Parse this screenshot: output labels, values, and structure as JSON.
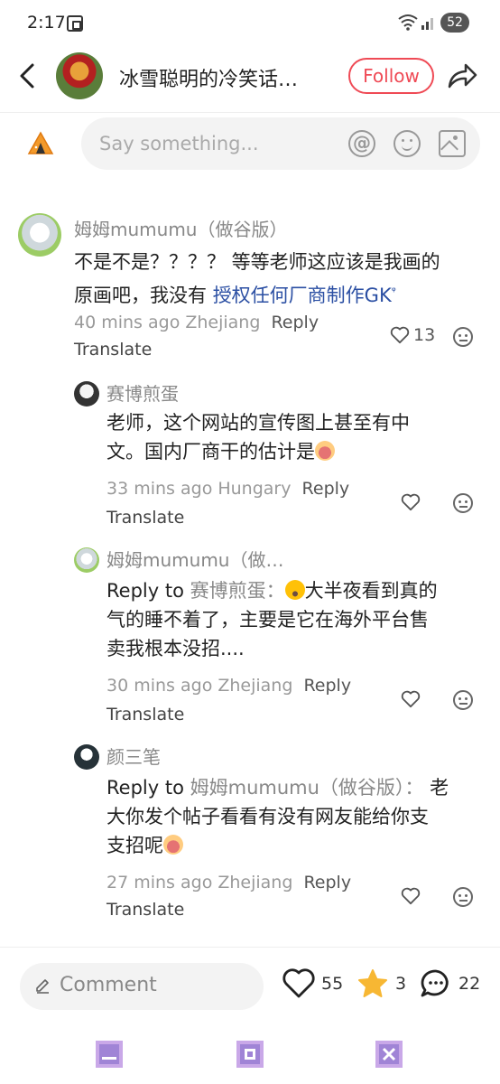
{
  "status_bar": {
    "time": "2:17",
    "battery": "52"
  },
  "header": {
    "title": "冰雪聪明的冷笑话…",
    "follow_label": "Follow"
  },
  "say_bar": {
    "placeholder": "Say something..."
  },
  "comments": [
    {
      "name": "姆姆mumumu（做谷版）",
      "line1": "不是不是？？？？ 等等老师这应该是我画的",
      "line2_prefix": "原画吧，我没有 ",
      "line2_link": "授权任何厂商制作GK",
      "time_location": "40 mins ago Zhejiang",
      "reply": "Reply",
      "translate": "Translate",
      "likes": "13"
    },
    {
      "name": "赛博煎蛋",
      "line1": "老师，这个网站的宣传图上甚至有中",
      "line2": "文。国内厂商干的估计是",
      "time_location": "33 mins ago Hungary",
      "reply": "Reply",
      "translate": "Translate"
    },
    {
      "name": "姆姆mumumu（做…",
      "reply_to_label": "Reply to",
      "reply_to_target": "赛博煎蛋：",
      "line1_rest": "大半夜看到真的",
      "line2": "气的睡不着了，主要是它在海外平台售",
      "line3": "卖我根本没招....",
      "time_location": "30 mins ago Zhejiang",
      "reply": "Reply",
      "translate": "Translate"
    },
    {
      "name": "颜三笔",
      "reply_to_label": "Reply to",
      "reply_to_target": "姆姆mumumu（做谷版）：",
      "line1_rest": "老",
      "line2": "大你发个帖子看看有没有网友能给你支",
      "line3": "支招呢",
      "time_location": "27 mins ago Zhejiang",
      "reply": "Reply",
      "translate": "Translate"
    }
  ],
  "bottom_bar": {
    "comment_placeholder": "Comment",
    "likes": "55",
    "stars": "3",
    "comments": "22"
  },
  "colors": {
    "accent": "#ef4a55",
    "link": "#2b4fa3",
    "star": "#f7b733"
  }
}
